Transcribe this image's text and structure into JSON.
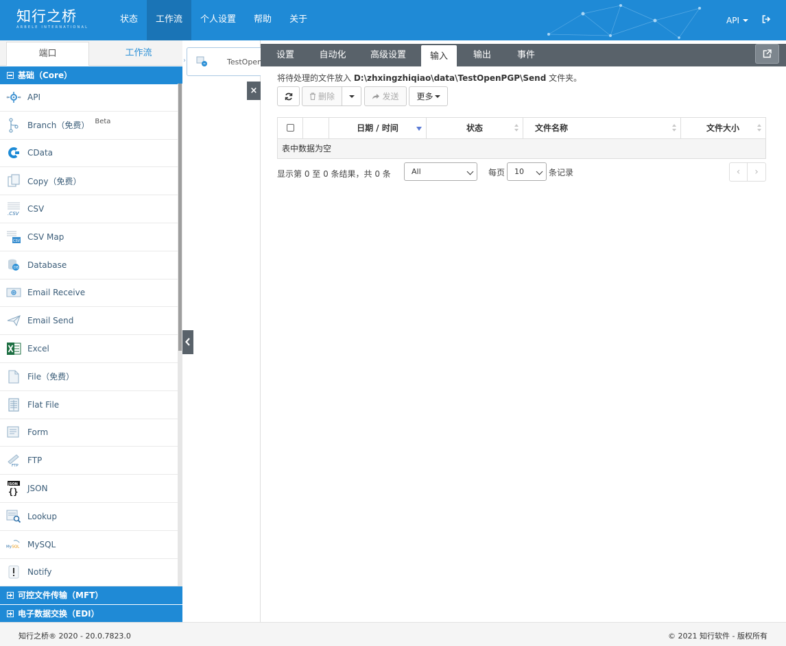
{
  "app": {
    "logo_text": "知行之桥",
    "logo_subtext": "ARBELE INTERNATIONAL",
    "user_menu": "API"
  },
  "nav": {
    "items": [
      {
        "label": "状态"
      },
      {
        "label": "工作流"
      },
      {
        "label": "个人设置"
      },
      {
        "label": "帮助"
      },
      {
        "label": "关于"
      }
    ],
    "active_index": 1
  },
  "sidebar": {
    "tabs": [
      {
        "label": "端口"
      },
      {
        "label": "工作流"
      }
    ],
    "groups": {
      "core": {
        "label": "基础（Core）"
      },
      "mft": {
        "label": "可控文件传输（MFT）"
      },
      "edi": {
        "label": "电子数据交换（EDI）"
      }
    },
    "items": [
      {
        "label": "API",
        "icon": "api-gear-icon"
      },
      {
        "label": "Branch（免费）",
        "badge": "Beta",
        "icon": "branch-icon"
      },
      {
        "label": "CData",
        "icon": "cdata-icon"
      },
      {
        "label": "Copy（免费）",
        "icon": "copy-icon"
      },
      {
        "label": "CSV",
        "icon": "csv-icon"
      },
      {
        "label": "CSV Map",
        "icon": "csv-map-icon"
      },
      {
        "label": "Database",
        "icon": "database-icon"
      },
      {
        "label": "Email Receive",
        "icon": "email-receive-icon"
      },
      {
        "label": "Email Send",
        "icon": "paper-plane-icon"
      },
      {
        "label": "Excel",
        "icon": "excel-icon"
      },
      {
        "label": "File（免费）",
        "icon": "file-icon"
      },
      {
        "label": "Flat File",
        "icon": "flat-file-icon"
      },
      {
        "label": "Form",
        "icon": "form-icon"
      },
      {
        "label": "FTP",
        "icon": "ftp-icon"
      },
      {
        "label": "JSON",
        "icon": "json-icon"
      },
      {
        "label": "Lookup",
        "icon": "lookup-icon"
      },
      {
        "label": "MySQL",
        "icon": "mysql-icon"
      },
      {
        "label": "Notify",
        "icon": "notify-icon"
      }
    ]
  },
  "canvas": {
    "node_label": "TestOpen"
  },
  "panel": {
    "tabs": [
      {
        "label": "设置"
      },
      {
        "label": "自动化"
      },
      {
        "label": "高级设置"
      },
      {
        "label": "输入"
      },
      {
        "label": "输出"
      },
      {
        "label": "事件"
      }
    ],
    "active_tab_index": 3,
    "info_prefix": "将待处理的文件放入",
    "info_path": "D:\\zhxingzhiqiao\\data\\TestOpenPGP\\Send",
    "info_suffix": "文件夹。",
    "toolbar": {
      "delete_label": "删除",
      "send_label": "发送",
      "more_label": "更多"
    },
    "table": {
      "columns": [
        "日期 / 时间",
        "状态",
        "文件名称",
        "文件大小"
      ],
      "empty_text": "表中数据为空",
      "rows": []
    },
    "pager": {
      "summary": "显示第 0 至 0 条结果，共 0 条",
      "filter_value": "All",
      "per_page_label": "每页",
      "per_page_value": "10",
      "records_label": "条记录",
      "prev": "‹",
      "next": "›"
    }
  },
  "footer": {
    "left": "知行之桥® 2020 - 20.0.7823.0",
    "right": "© 2021 知行软件 - 版权所有"
  },
  "colors": {
    "primary": "#1f8ad6",
    "primary_dark": "#1a74b6",
    "panel_tabbar": "#59626a"
  }
}
